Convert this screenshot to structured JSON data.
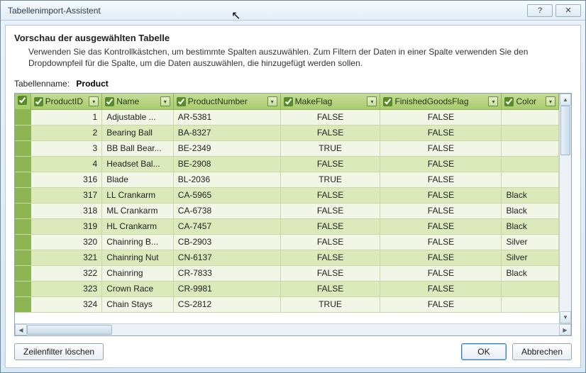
{
  "window": {
    "title": "Tabellenimport-Assistent",
    "help_btn": "?",
    "close_btn": "✕"
  },
  "heading": "Vorschau der ausgewählten Tabelle",
  "description": "Verwenden Sie das Kontrollkästchen, um bestimmte Spalten auszuwählen. Zum Filtern der Daten in einer Spalte verwenden Sie den Dropdownpfeil für die Spalte, um die Daten auszuwählen, die hinzugefügt werden sollen.",
  "tablename_label": "Tabellenname:",
  "tablename_value": "Product",
  "columns": [
    {
      "key": "ProductID",
      "label": "ProductID",
      "checked": true
    },
    {
      "key": "Name",
      "label": "Name",
      "checked": true
    },
    {
      "key": "ProductNumber",
      "label": "ProductNumber",
      "checked": true
    },
    {
      "key": "MakeFlag",
      "label": "MakeFlag",
      "checked": true
    },
    {
      "key": "FinishedGoodsFlag",
      "label": "FinishedGoodsFlag",
      "checked": true
    },
    {
      "key": "Color",
      "label": "Color",
      "checked": true
    }
  ],
  "rows": [
    {
      "ProductID": "1",
      "Name": "Adjustable ...",
      "ProductNumber": "AR-5381",
      "MakeFlag": "FALSE",
      "FinishedGoodsFlag": "FALSE",
      "Color": ""
    },
    {
      "ProductID": "2",
      "Name": "Bearing Ball",
      "ProductNumber": "BA-8327",
      "MakeFlag": "FALSE",
      "FinishedGoodsFlag": "FALSE",
      "Color": ""
    },
    {
      "ProductID": "3",
      "Name": "BB Ball Bear...",
      "ProductNumber": "BE-2349",
      "MakeFlag": "TRUE",
      "FinishedGoodsFlag": "FALSE",
      "Color": ""
    },
    {
      "ProductID": "4",
      "Name": "Headset Bal...",
      "ProductNumber": "BE-2908",
      "MakeFlag": "FALSE",
      "FinishedGoodsFlag": "FALSE",
      "Color": ""
    },
    {
      "ProductID": "316",
      "Name": "Blade",
      "ProductNumber": "BL-2036",
      "MakeFlag": "TRUE",
      "FinishedGoodsFlag": "FALSE",
      "Color": ""
    },
    {
      "ProductID": "317",
      "Name": "LL Crankarm",
      "ProductNumber": "CA-5965",
      "MakeFlag": "FALSE",
      "FinishedGoodsFlag": "FALSE",
      "Color": "Black"
    },
    {
      "ProductID": "318",
      "Name": "ML Crankarm",
      "ProductNumber": "CA-6738",
      "MakeFlag": "FALSE",
      "FinishedGoodsFlag": "FALSE",
      "Color": "Black"
    },
    {
      "ProductID": "319",
      "Name": "HL Crankarm",
      "ProductNumber": "CA-7457",
      "MakeFlag": "FALSE",
      "FinishedGoodsFlag": "FALSE",
      "Color": "Black"
    },
    {
      "ProductID": "320",
      "Name": "Chainring B...",
      "ProductNumber": "CB-2903",
      "MakeFlag": "FALSE",
      "FinishedGoodsFlag": "FALSE",
      "Color": "Silver"
    },
    {
      "ProductID": "321",
      "Name": "Chainring Nut",
      "ProductNumber": "CN-6137",
      "MakeFlag": "FALSE",
      "FinishedGoodsFlag": "FALSE",
      "Color": "Silver"
    },
    {
      "ProductID": "322",
      "Name": "Chainring",
      "ProductNumber": "CR-7833",
      "MakeFlag": "FALSE",
      "FinishedGoodsFlag": "FALSE",
      "Color": "Black"
    },
    {
      "ProductID": "323",
      "Name": "Crown Race",
      "ProductNumber": "CR-9981",
      "MakeFlag": "FALSE",
      "FinishedGoodsFlag": "FALSE",
      "Color": ""
    },
    {
      "ProductID": "324",
      "Name": "Chain Stays",
      "ProductNumber": "CS-2812",
      "MakeFlag": "TRUE",
      "FinishedGoodsFlag": "FALSE",
      "Color": ""
    }
  ],
  "buttons": {
    "clear_filters": "Zeilenfilter löschen",
    "ok": "OK",
    "cancel": "Abbrechen"
  },
  "icons": {
    "filter_dropdown": "▾",
    "scroll_up": "▲",
    "scroll_down": "▼",
    "scroll_left": "◀",
    "scroll_right": "▶"
  }
}
